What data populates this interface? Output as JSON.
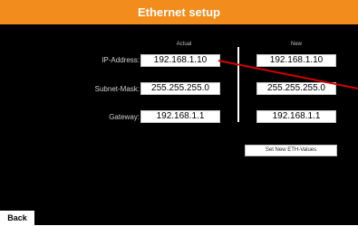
{
  "title": "Ethernet setup",
  "columns": {
    "actual": "Actual",
    "new": "New"
  },
  "rows": [
    {
      "label": "IP-Address:",
      "actual": "192.168.1.10",
      "new": "192.168.1.10"
    },
    {
      "label": "Subnet-Mask:",
      "actual": "255.255.255.0",
      "new": "255.255.255.0"
    },
    {
      "label": "Gateway:",
      "actual": "192.168.1.1",
      "new": "192.168.1.1"
    }
  ],
  "set_button_label": "Set New ETH-Values",
  "back_button_label": "Back",
  "colors": {
    "title_bar": "#f28c1c",
    "background": "#000000",
    "pointer": "#d40000"
  }
}
